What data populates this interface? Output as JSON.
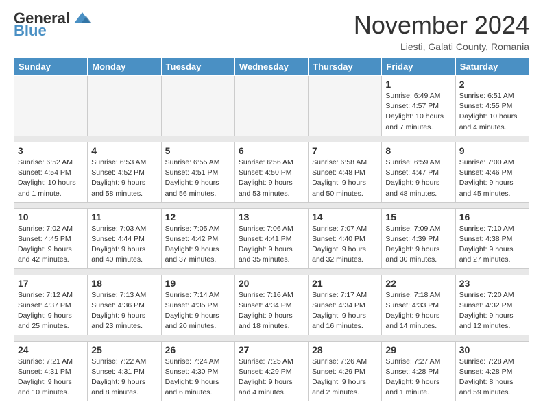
{
  "header": {
    "logo_general": "General",
    "logo_blue": "Blue",
    "month_title": "November 2024",
    "location": "Liesti, Galati County, Romania"
  },
  "days_of_week": [
    "Sunday",
    "Monday",
    "Tuesday",
    "Wednesday",
    "Thursday",
    "Friday",
    "Saturday"
  ],
  "weeks": [
    [
      {
        "day": "",
        "info": ""
      },
      {
        "day": "",
        "info": ""
      },
      {
        "day": "",
        "info": ""
      },
      {
        "day": "",
        "info": ""
      },
      {
        "day": "",
        "info": ""
      },
      {
        "day": "1",
        "info": "Sunrise: 6:49 AM\nSunset: 4:57 PM\nDaylight: 10 hours\nand 7 minutes."
      },
      {
        "day": "2",
        "info": "Sunrise: 6:51 AM\nSunset: 4:55 PM\nDaylight: 10 hours\nand 4 minutes."
      }
    ],
    [
      {
        "day": "3",
        "info": "Sunrise: 6:52 AM\nSunset: 4:54 PM\nDaylight: 10 hours\nand 1 minute."
      },
      {
        "day": "4",
        "info": "Sunrise: 6:53 AM\nSunset: 4:52 PM\nDaylight: 9 hours\nand 58 minutes."
      },
      {
        "day": "5",
        "info": "Sunrise: 6:55 AM\nSunset: 4:51 PM\nDaylight: 9 hours\nand 56 minutes."
      },
      {
        "day": "6",
        "info": "Sunrise: 6:56 AM\nSunset: 4:50 PM\nDaylight: 9 hours\nand 53 minutes."
      },
      {
        "day": "7",
        "info": "Sunrise: 6:58 AM\nSunset: 4:48 PM\nDaylight: 9 hours\nand 50 minutes."
      },
      {
        "day": "8",
        "info": "Sunrise: 6:59 AM\nSunset: 4:47 PM\nDaylight: 9 hours\nand 48 minutes."
      },
      {
        "day": "9",
        "info": "Sunrise: 7:00 AM\nSunset: 4:46 PM\nDaylight: 9 hours\nand 45 minutes."
      }
    ],
    [
      {
        "day": "10",
        "info": "Sunrise: 7:02 AM\nSunset: 4:45 PM\nDaylight: 9 hours\nand 42 minutes."
      },
      {
        "day": "11",
        "info": "Sunrise: 7:03 AM\nSunset: 4:44 PM\nDaylight: 9 hours\nand 40 minutes."
      },
      {
        "day": "12",
        "info": "Sunrise: 7:05 AM\nSunset: 4:42 PM\nDaylight: 9 hours\nand 37 minutes."
      },
      {
        "day": "13",
        "info": "Sunrise: 7:06 AM\nSunset: 4:41 PM\nDaylight: 9 hours\nand 35 minutes."
      },
      {
        "day": "14",
        "info": "Sunrise: 7:07 AM\nSunset: 4:40 PM\nDaylight: 9 hours\nand 32 minutes."
      },
      {
        "day": "15",
        "info": "Sunrise: 7:09 AM\nSunset: 4:39 PM\nDaylight: 9 hours\nand 30 minutes."
      },
      {
        "day": "16",
        "info": "Sunrise: 7:10 AM\nSunset: 4:38 PM\nDaylight: 9 hours\nand 27 minutes."
      }
    ],
    [
      {
        "day": "17",
        "info": "Sunrise: 7:12 AM\nSunset: 4:37 PM\nDaylight: 9 hours\nand 25 minutes."
      },
      {
        "day": "18",
        "info": "Sunrise: 7:13 AM\nSunset: 4:36 PM\nDaylight: 9 hours\nand 23 minutes."
      },
      {
        "day": "19",
        "info": "Sunrise: 7:14 AM\nSunset: 4:35 PM\nDaylight: 9 hours\nand 20 minutes."
      },
      {
        "day": "20",
        "info": "Sunrise: 7:16 AM\nSunset: 4:34 PM\nDaylight: 9 hours\nand 18 minutes."
      },
      {
        "day": "21",
        "info": "Sunrise: 7:17 AM\nSunset: 4:34 PM\nDaylight: 9 hours\nand 16 minutes."
      },
      {
        "day": "22",
        "info": "Sunrise: 7:18 AM\nSunset: 4:33 PM\nDaylight: 9 hours\nand 14 minutes."
      },
      {
        "day": "23",
        "info": "Sunrise: 7:20 AM\nSunset: 4:32 PM\nDaylight: 9 hours\nand 12 minutes."
      }
    ],
    [
      {
        "day": "24",
        "info": "Sunrise: 7:21 AM\nSunset: 4:31 PM\nDaylight: 9 hours\nand 10 minutes."
      },
      {
        "day": "25",
        "info": "Sunrise: 7:22 AM\nSunset: 4:31 PM\nDaylight: 9 hours\nand 8 minutes."
      },
      {
        "day": "26",
        "info": "Sunrise: 7:24 AM\nSunset: 4:30 PM\nDaylight: 9 hours\nand 6 minutes."
      },
      {
        "day": "27",
        "info": "Sunrise: 7:25 AM\nSunset: 4:29 PM\nDaylight: 9 hours\nand 4 minutes."
      },
      {
        "day": "28",
        "info": "Sunrise: 7:26 AM\nSunset: 4:29 PM\nDaylight: 9 hours\nand 2 minutes."
      },
      {
        "day": "29",
        "info": "Sunrise: 7:27 AM\nSunset: 4:28 PM\nDaylight: 9 hours\nand 1 minute."
      },
      {
        "day": "30",
        "info": "Sunrise: 7:28 AM\nSunset: 4:28 PM\nDaylight: 8 hours\nand 59 minutes."
      }
    ]
  ]
}
